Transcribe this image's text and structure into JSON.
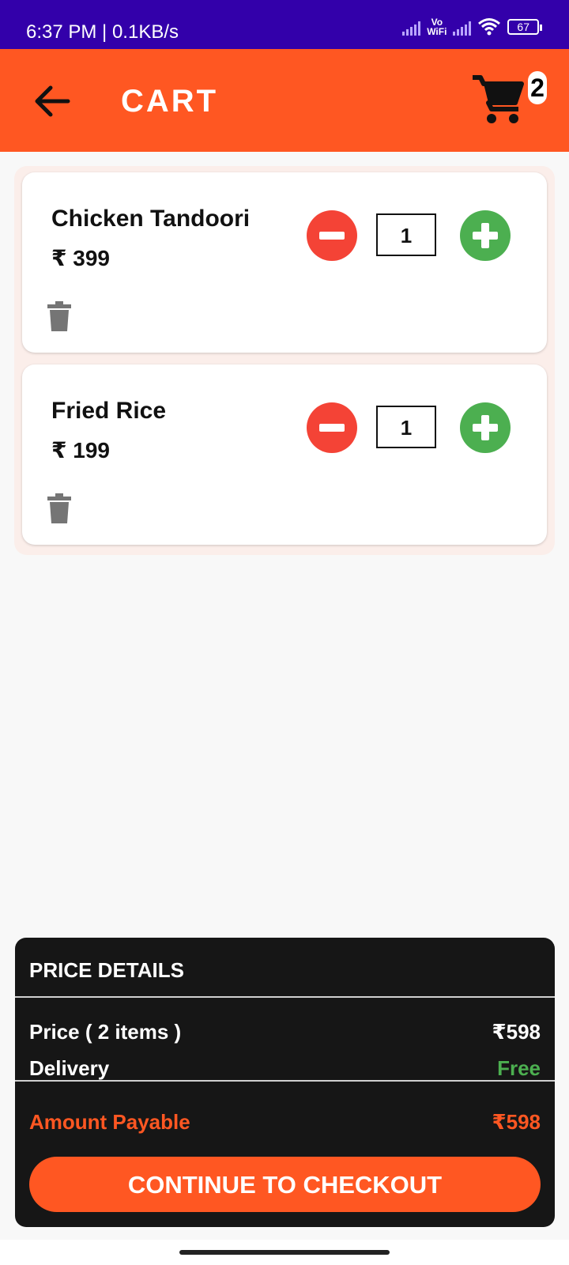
{
  "status_bar": {
    "time": "6:37 PM | 0.1KB/s",
    "vowifi_top": "Vo",
    "vowifi_bottom": "WiFi",
    "battery": "67"
  },
  "app_bar": {
    "title": "CART",
    "cart_count": "2"
  },
  "cart_items": [
    {
      "name": "Chicken Tandoori",
      "price": "₹ 399",
      "quantity": "1"
    },
    {
      "name": "Fried Rice",
      "price": "₹ 199",
      "quantity": "1"
    }
  ],
  "price_details": {
    "title": "PRICE DETAILS",
    "price_label": "Price ( 2 items )",
    "price_value": "₹598",
    "delivery_label": "Delivery",
    "delivery_value": "Free",
    "amount_label": "Amount Payable",
    "amount_value": "₹598",
    "checkout_label": "CONTINUE TO CHECKOUT"
  },
  "colors": {
    "status_bar": "#3300aa",
    "primary": "#ff5722",
    "minus": "#f44336",
    "plus": "#4caf50",
    "panel": "#161616"
  }
}
